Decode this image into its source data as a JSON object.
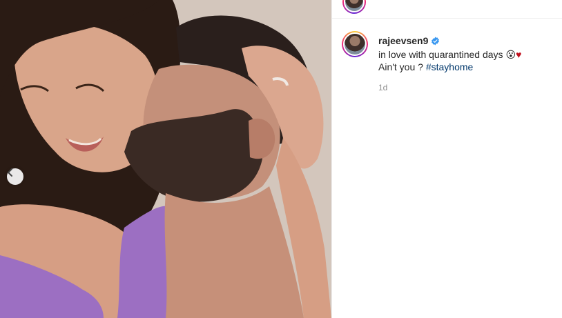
{
  "post": {
    "author": "rajeevsen9",
    "caption_line1": "in love with quarantined days",
    "caption_emoji": "😮",
    "caption_heart": "♥",
    "caption_line2_prefix": "Ain't you ?",
    "hashtag": "#stayhome",
    "timestamp": "1d"
  },
  "icons": {
    "carousel_prev": "chevron-left-icon",
    "verified": "verified-badge-icon"
  },
  "colors": {
    "hashtag": "#00376b",
    "verified": "#3897f0",
    "heart": "#c0101d",
    "timestamp": "#8e8e8e"
  }
}
